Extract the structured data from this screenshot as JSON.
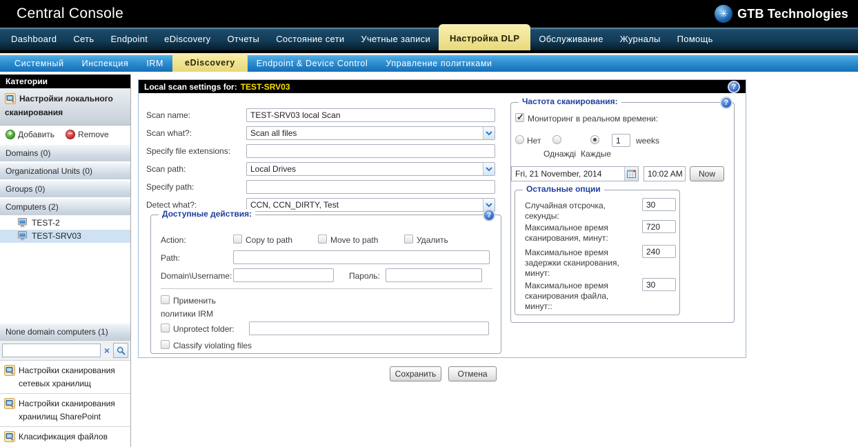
{
  "header": {
    "app_title": "Central Console",
    "brand_name": "GTB Technologies",
    "logo_glyph": "✳"
  },
  "nav": {
    "items": [
      "Dashboard",
      "Сеть",
      "Endpoint",
      "eDiscovery",
      "Отчеты",
      "Состояние сети",
      "Учетные записи",
      "Настройка DLP",
      "Обслуживание",
      "Журналы",
      "Помощь"
    ],
    "active": "Настройка DLP"
  },
  "subnav": {
    "items": [
      "Системный",
      "Инспекция",
      "IRM",
      "eDiscovery",
      "Endpoint & Device Control",
      "Управление политиками"
    ],
    "active": "eDiscovery"
  },
  "sidebar": {
    "title": "Категории",
    "local_scan_item": "Настройки локального сканирования",
    "add_label": "Добавить",
    "remove_label": "Remove",
    "groups": [
      "Domains (0)",
      "Organizational Units (0)",
      "Groups (0)",
      "Computers (2)"
    ],
    "computers": [
      "TEST-2",
      "TEST-SRV03"
    ],
    "selected_computer": "TEST-SRV03",
    "none_domain": "None domain computers (1)",
    "search_value": "",
    "bottom_items": [
      "Настройки сканирования сетевых хранилищ",
      "Настройки сканирования хранилищ SharePoint",
      "Класификация файлов"
    ]
  },
  "main": {
    "title_prefix": "Local scan settings for:",
    "title_target": "TEST-SRV03",
    "form": {
      "scan_name_label": "Scan name:",
      "scan_name_value": "TEST-SRV03 local Scan",
      "scan_what_label": "Scan what?:",
      "scan_what_value": "Scan all files",
      "file_ext_label": "Specify file extensions:",
      "file_ext_value": "",
      "scan_path_label": "Scan path:",
      "scan_path_value": "Local Drives",
      "specify_path_label": "Specify path:",
      "specify_path_value": "",
      "detect_label": "Detect what?:",
      "detect_value": "CCN, CCN_DIRTY, Test"
    },
    "actions": {
      "legend": "Доступные действия:",
      "action_label": "Action:",
      "checkbox_copy": "Copy to path",
      "checkbox_move": "Move to path",
      "checkbox_delete": "Удалить",
      "path_label": "Path:",
      "domain_label": "Domain\\Username:",
      "password_label": "Пароль:",
      "irm_line1": "Применить",
      "irm_line2": "политики IRM",
      "unprotect_label": "Unprotect folder:",
      "unprotect_value": "",
      "classify_label": "Classify violating files"
    },
    "frequency": {
      "legend": "Частота сканирования:",
      "realtime_label": "Мониторинг в реальном времени:",
      "radio_no": "Нет",
      "radio_once": "Однаждi",
      "radio_every": "Каждые",
      "weeks_value": "1",
      "weeks_label": "weeks",
      "date_value": "Fri, 21 November, 2014",
      "time_value": "10:02 AM",
      "now_label": "Now"
    },
    "other": {
      "legend": "Остальные опции",
      "rows": [
        {
          "label": "Случайная отсрочка, секунды:",
          "value": "30"
        },
        {
          "label": "Максимальное время сканирования, минут:",
          "value": "720"
        },
        {
          "label": "Максимальное время задержки сканирования, минут:",
          "value": "240"
        },
        {
          "label": "Максимальное время сканирования файла, минут::",
          "value": "30"
        }
      ]
    },
    "save_label": "Сохранить",
    "cancel_label": "Отмена"
  },
  "colors": {
    "accent_tab_yellow": "#e9d87b",
    "nav_dark_blue": "#133d59",
    "subnav_blue": "#2e8ed2",
    "title_target_yellow": "#ffe200",
    "legend_blue": "#1e3f9e",
    "selected_row_blue": "#cfe2f4"
  }
}
